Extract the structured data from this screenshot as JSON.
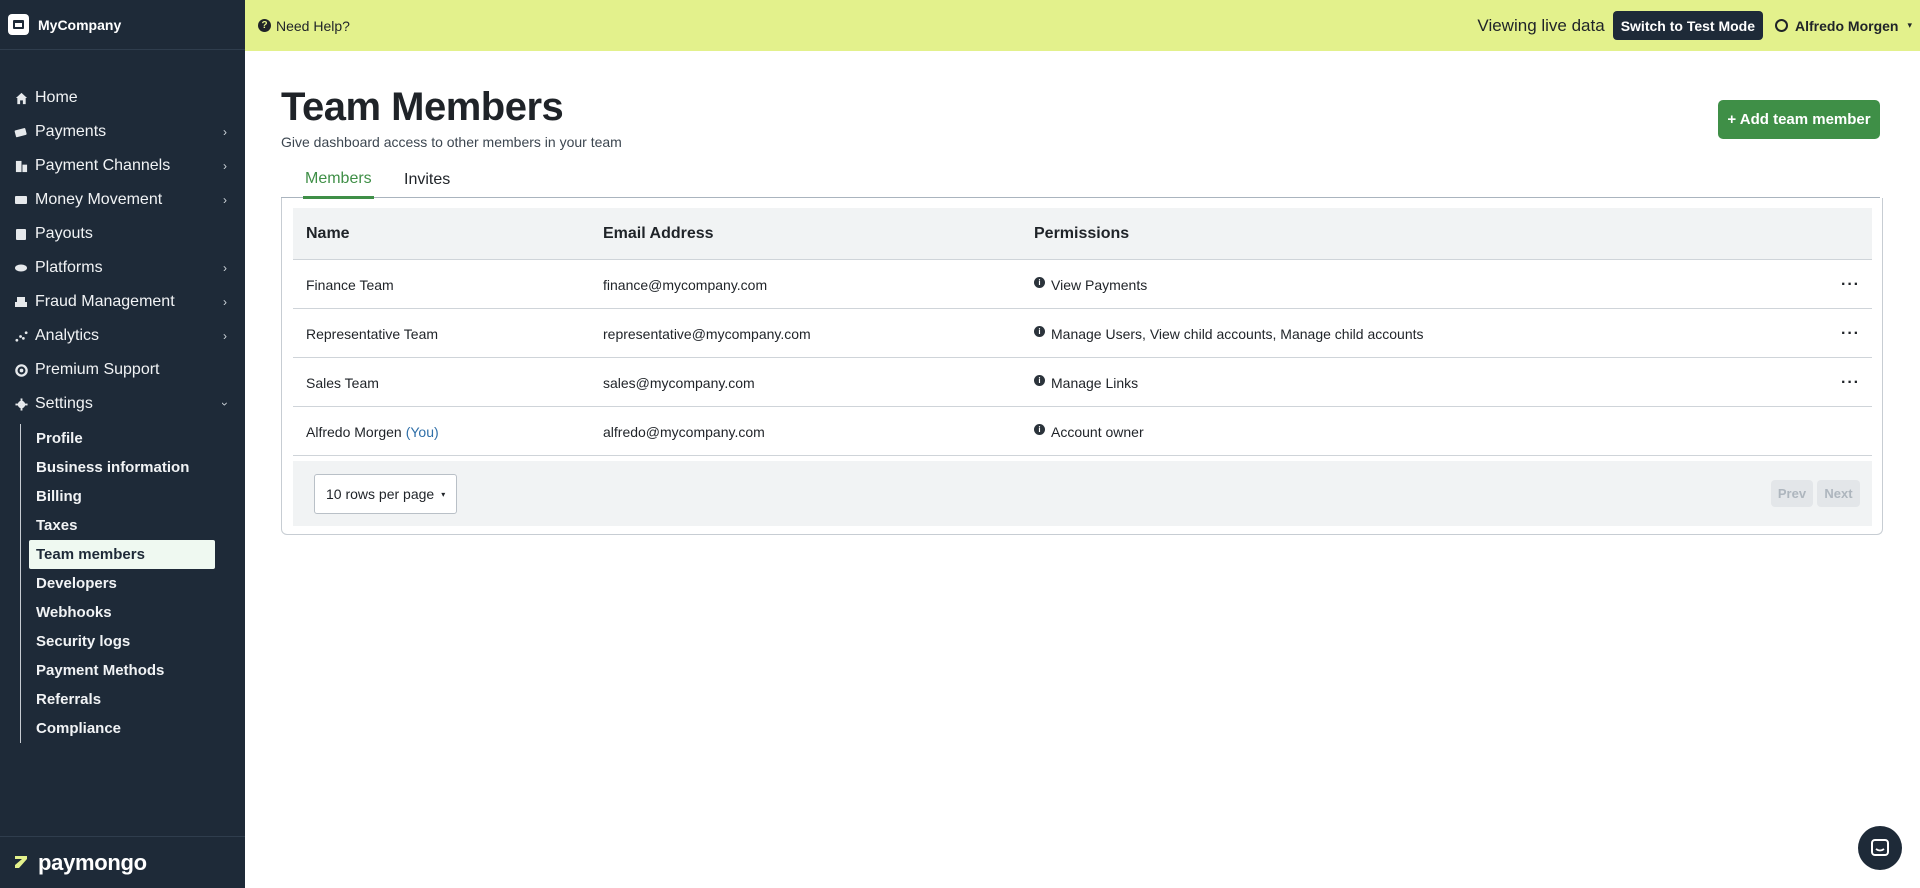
{
  "brand": {
    "name": "MyCompany"
  },
  "topbar": {
    "help_label": "Need Help?",
    "live_label": "Viewing live data",
    "test_mode_label": "Switch to Test Mode",
    "user_name": "Alfredo Morgen"
  },
  "sidebar": {
    "items": [
      {
        "label": "Home",
        "icon": "home-icon",
        "chevron": false
      },
      {
        "label": "Payments",
        "icon": "payments-icon",
        "chevron": true
      },
      {
        "label": "Payment Channels",
        "icon": "channels-icon",
        "chevron": true
      },
      {
        "label": "Money Movement",
        "icon": "money-icon",
        "chevron": true
      },
      {
        "label": "Payouts",
        "icon": "payouts-icon",
        "chevron": false
      },
      {
        "label": "Platforms",
        "icon": "platforms-icon",
        "chevron": true
      },
      {
        "label": "Fraud Management",
        "icon": "fraud-icon",
        "chevron": true
      },
      {
        "label": "Analytics",
        "icon": "analytics-icon",
        "chevron": true
      },
      {
        "label": "Premium Support",
        "icon": "support-icon",
        "chevron": false
      },
      {
        "label": "Settings",
        "icon": "settings-icon",
        "chevron": true
      }
    ],
    "settings_items": [
      "Profile",
      "Business information",
      "Billing",
      "Taxes",
      "Team members",
      "Developers",
      "Webhooks",
      "Security logs",
      "Payment Methods",
      "Referrals",
      "Compliance"
    ],
    "active_settings_item": "Team members",
    "footer_brand": "paymongo"
  },
  "page": {
    "title": "Team Members",
    "subtitle": "Give dashboard access to other members in your team",
    "add_button": "+ Add team member"
  },
  "tabs": [
    {
      "label": "Members",
      "active": true
    },
    {
      "label": "Invites",
      "active": false
    }
  ],
  "table": {
    "headers": {
      "name": "Name",
      "email": "Email Address",
      "permissions": "Permissions"
    },
    "rows": [
      {
        "name": "Finance Team",
        "you": "",
        "email": "finance@mycompany.com",
        "permissions": "View Payments",
        "has_menu": true
      },
      {
        "name": "Representative Team",
        "you": "",
        "email": "representative@mycompany.com",
        "permissions": "Manage Users, View child accounts, Manage child accounts",
        "has_menu": true
      },
      {
        "name": "Sales Team",
        "you": "",
        "email": "sales@mycompany.com",
        "permissions": "Manage Links",
        "has_menu": true
      },
      {
        "name": "Alfredo Morgen",
        "you": "(You)",
        "email": "alfredo@mycompany.com",
        "permissions": "Account owner",
        "has_menu": false
      }
    ],
    "rows_per_page": "10 rows per page",
    "prev_label": "Prev",
    "next_label": "Next"
  },
  "colors": {
    "sidebar_bg": "#1e2a38",
    "topbar_bg": "#e3f18c",
    "accent_green": "#3f8f47",
    "you_blue": "#2f6fa8"
  }
}
